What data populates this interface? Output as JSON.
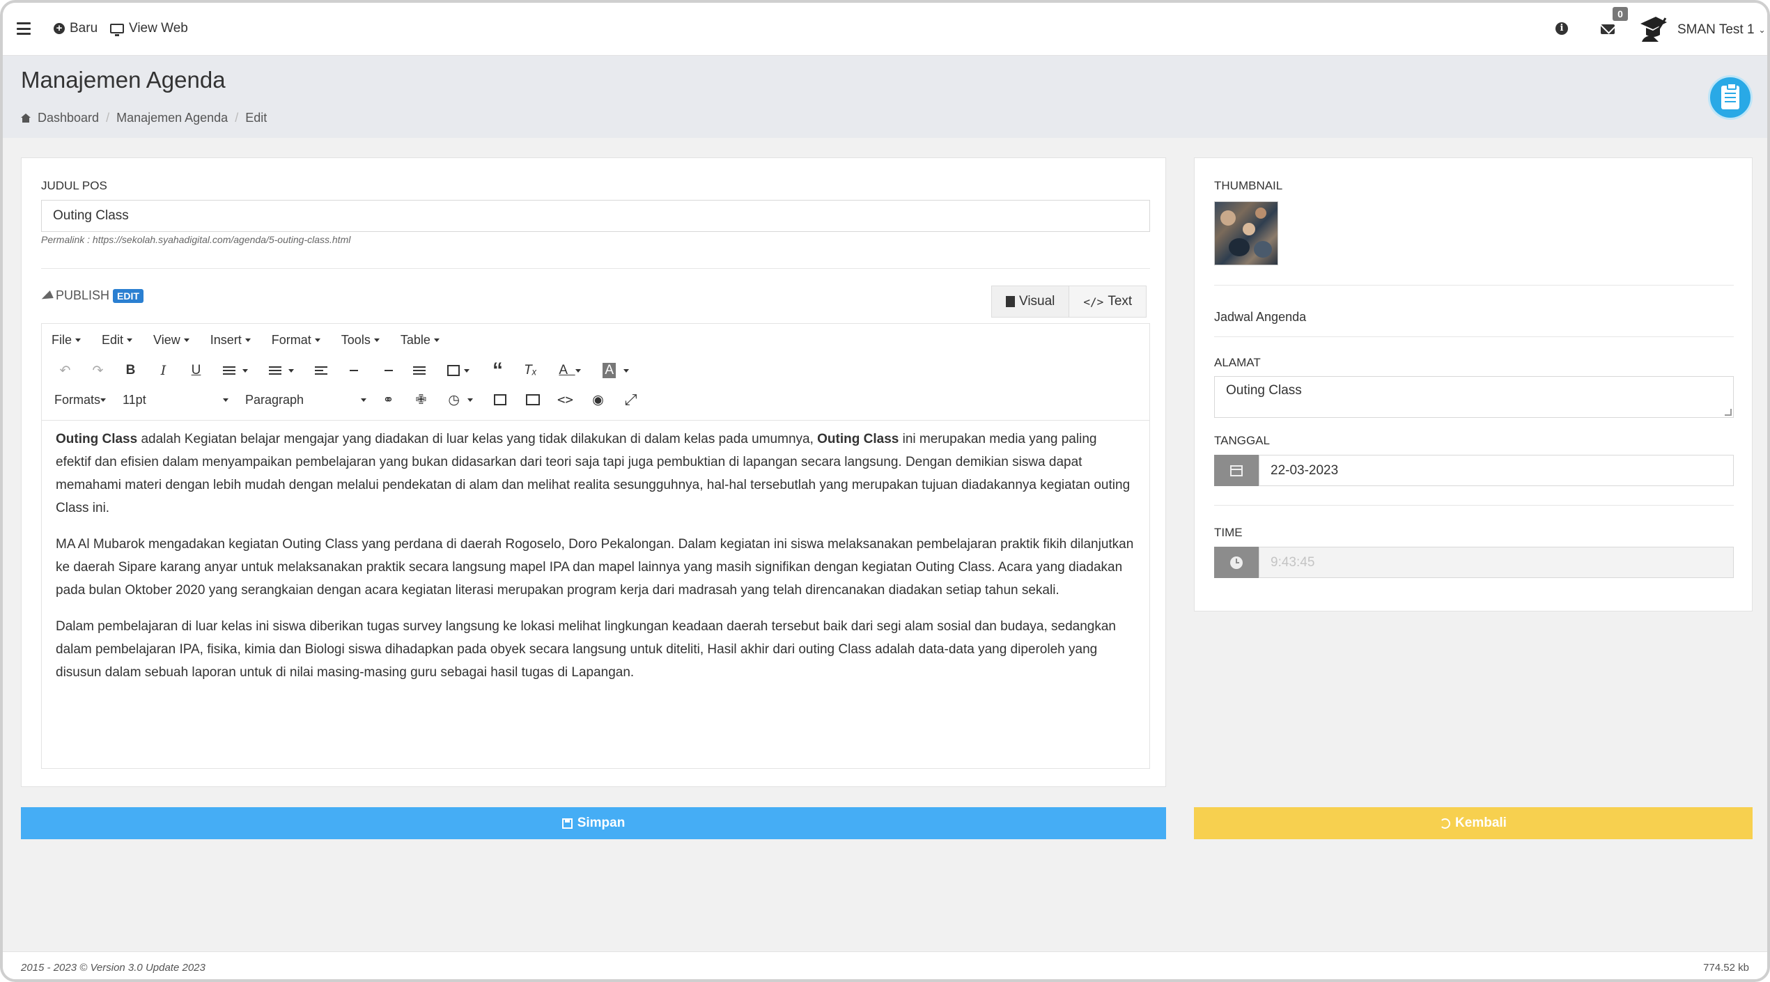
{
  "topbar": {
    "new_label": "Baru",
    "view_web_label": "View Web",
    "mail_count": "0",
    "user_name": "SMAN Test 1"
  },
  "header": {
    "title": "Manajemen Agenda",
    "breadcrumb": [
      "Dashboard",
      "Manajemen Agenda",
      "Edit"
    ]
  },
  "form": {
    "title_label": "JUDUL POS",
    "title_value": "Outing Class",
    "permalink": "Permalink : https://sekolah.syahadigital.com/agenda/5-outing-class.html",
    "publish_label": "PUBLISH",
    "edit_badge": "EDIT",
    "tab_visual": "Visual",
    "tab_text": "Text"
  },
  "editor": {
    "menus": [
      "File",
      "Edit",
      "View",
      "Insert",
      "Format",
      "Tools",
      "Table"
    ],
    "formats_label": "Formats",
    "font_size": "11pt",
    "block_format": "Paragraph",
    "paragraphs": [
      {
        "segments": [
          {
            "text": "Outing Class",
            "bold": true
          },
          {
            "text": " adalah Kegiatan belajar mengajar yang diadakan di luar kelas yang tidak dilakukan di dalam kelas pada umumnya, ",
            "bold": false
          },
          {
            "text": "Outing Class",
            "bold": true
          },
          {
            "text": " ini merupakan media yang paling efektif dan efisien dalam menyampaikan pembelajaran yang bukan didasarkan dari teori saja tapi juga pembuktian di lapangan secara langsung. Dengan demikian siswa dapat memahami materi dengan lebih mudah dengan melalui  pendekatan di alam dan  melihat realita sesungguhnya, hal-hal tersebutlah yang merupakan tujuan diadakannya kegiatan outing Class ini.",
            "bold": false
          }
        ]
      },
      {
        "segments": [
          {
            "text": "MA Al Mubarok mengadakan kegiatan Outing Class yang perdana di daerah Rogoselo, Doro Pekalongan. Dalam kegiatan ini siswa melaksanakan pembelajaran praktik fikih dilanjutkan ke daerah Sipare karang anyar untuk melaksanakan praktik secara langsung mapel IPA dan mapel lainnya yang masih signifikan dengan kegiatan Outing Class. Acara yang diadakan  pada bulan Oktober 2020 yang serangkaian dengan acara kegiatan literasi merupakan program kerja dari madrasah yang telah direncanakan diadakan setiap tahun sekali.",
            "bold": false
          }
        ]
      },
      {
        "segments": [
          {
            "text": "Dalam pembelajaran di luar kelas ini siswa diberikan tugas survey langsung ke lokasi melihat lingkungan keadaan daerah tersebut baik dari segi alam sosial dan  budaya, sedangkan dalam pembelajaran IPA, fisika, kimia dan Biologi siswa dihadapkan pada obyek secara langsung untuk diteliti, Hasil akhir dari outing Class adalah data-data yang diperoleh  yang disusun  dalam sebuah laporan untuk di nilai masing-masing guru sebagai hasil tugas di Lapangan.",
            "bold": false
          }
        ]
      }
    ]
  },
  "side": {
    "thumbnail_label": "THUMBNAIL",
    "category_text": "Jadwal Angenda",
    "alamat_label": "ALAMAT",
    "alamat_value": "Outing Class",
    "tanggal_label": "TANGGAL",
    "tanggal_value": "22-03-2023",
    "time_label": "TIME",
    "time_value": "9:43:45"
  },
  "buttons": {
    "save": "Simpan",
    "back": "Kembali"
  },
  "footer": {
    "left": "2015 - 2023 © Version 3.0 Update 2023",
    "right": "774.52 kb"
  },
  "colors": {
    "save": "#45adf5",
    "back": "#f7d04f",
    "edit_badge": "#2a7fd1",
    "clipboard_icon": "#29a9e6"
  }
}
